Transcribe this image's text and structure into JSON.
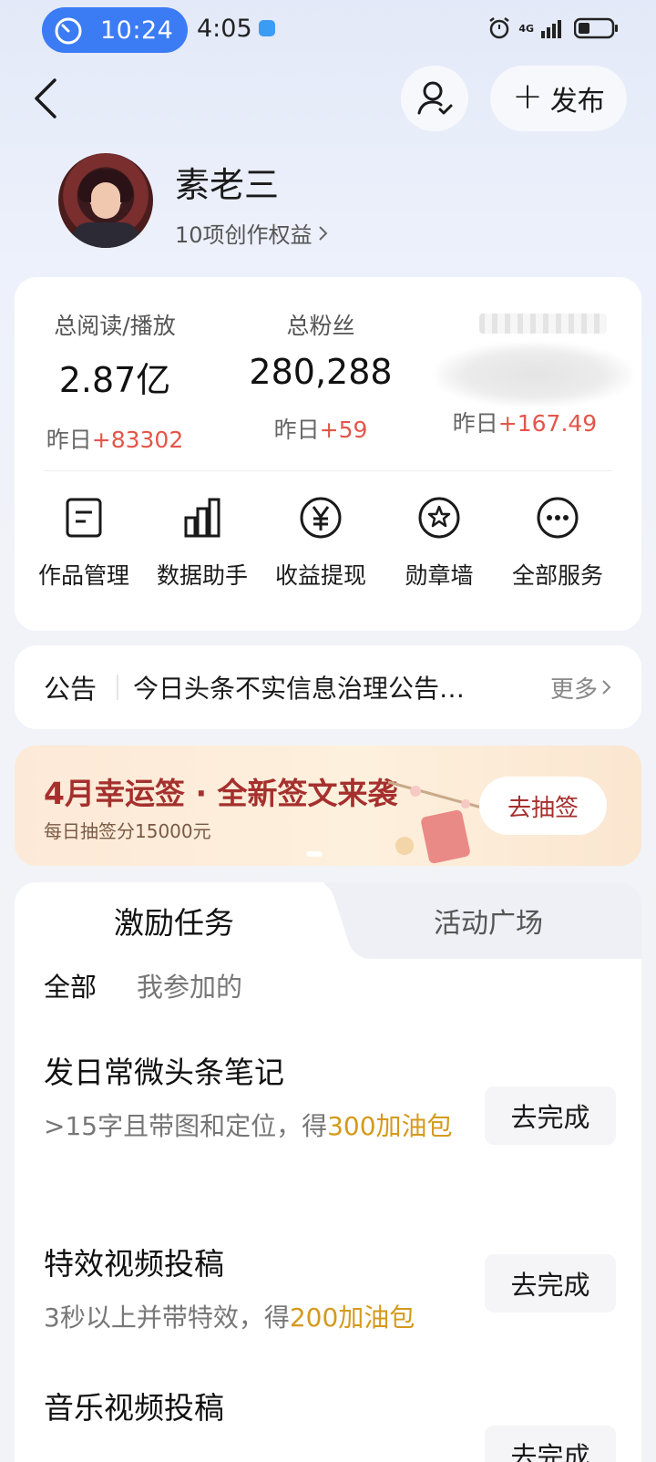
{
  "status_bar": {
    "timer": "10:24",
    "clock": "4:05",
    "network": "4G"
  },
  "header": {
    "publish_label": "发布"
  },
  "profile": {
    "name": "素老三",
    "rights": "10项创作权益"
  },
  "stats": [
    {
      "label": "总阅读/播放",
      "value": "2.87亿",
      "delta_prefix": "昨日",
      "delta": "+83302"
    },
    {
      "label": "总粉丝",
      "value": "280,288",
      "delta_prefix": "昨日",
      "delta": "+59"
    },
    {
      "label": "",
      "value": "",
      "delta_prefix": "昨日",
      "delta": "+167.49"
    }
  ],
  "services": [
    {
      "label": "作品管理",
      "icon": "document-icon"
    },
    {
      "label": "数据助手",
      "icon": "bar-chart-icon"
    },
    {
      "label": "收益提现",
      "icon": "yen-icon"
    },
    {
      "label": "勋章墙",
      "icon": "medal-icon"
    },
    {
      "label": "全部服务",
      "icon": "more-icon"
    }
  ],
  "notice": {
    "title": "公告",
    "text": "今日头条不实信息治理公告…",
    "more": "更多"
  },
  "banner": {
    "title": "4月幸运签 · 全新签文来袭",
    "subtitle": "每日抽签分15000元",
    "button": "去抽签"
  },
  "tasks": {
    "tabs": [
      "激励任务",
      "活动广场"
    ],
    "filters": [
      "全部",
      "我参加的"
    ],
    "items": [
      {
        "title": "发日常微头条笔记",
        "desc_prefix": ">15字且带图和定位，得",
        "reward": "300加油包",
        "button": "去完成"
      },
      {
        "title": "特效视频投稿",
        "desc_prefix": "3秒以上并带特效，得",
        "reward": "200加油包",
        "button": "去完成"
      },
      {
        "title": "音乐视频投稿",
        "desc_prefix": "",
        "reward": "",
        "button": "去完成"
      }
    ]
  },
  "colors": {
    "accent_blue": "#3b7cf4",
    "delta_red": "#e3564a",
    "reward_gold": "#d49a1c",
    "banner_red": "#a5302d"
  }
}
